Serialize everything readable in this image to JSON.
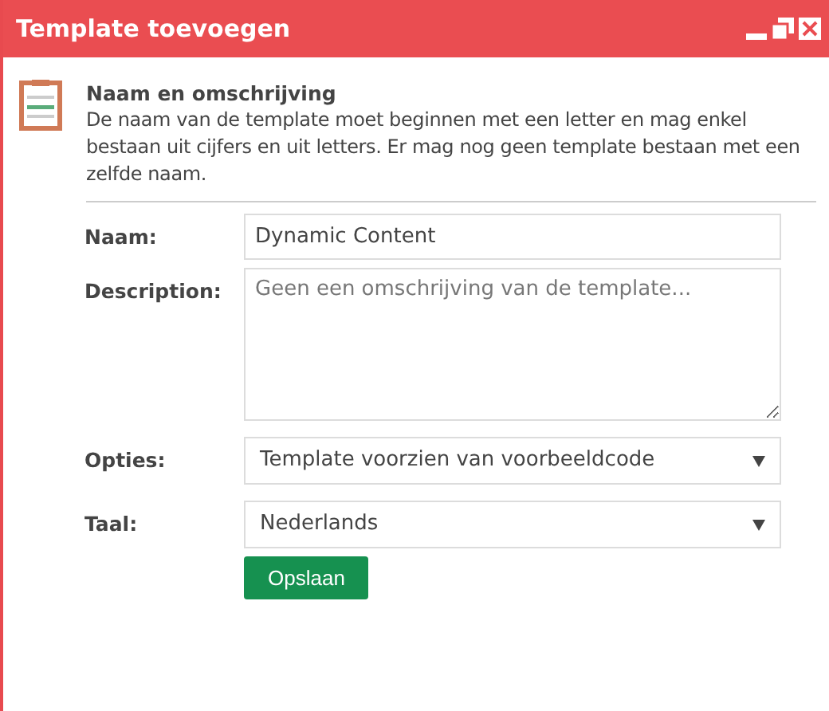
{
  "window": {
    "title": "Template toevoegen"
  },
  "section": {
    "title": "Naam en omschrijving",
    "description": "De naam van de template moet beginnen met een letter en mag enkel bestaan uit cijfers en uit letters. Er mag nog geen template bestaan met een zelfde naam."
  },
  "fields": [
    {
      "kind": "input",
      "label": "Naam:",
      "value": "Dynamic Content"
    },
    {
      "kind": "textarea",
      "label": "Description:",
      "placeholder": "Geen een omschrijving van de template..."
    },
    {
      "kind": "select",
      "label": "Opties:",
      "value": "Template voorzien van voorbeeldcode"
    },
    {
      "kind": "select",
      "label": "Taal:",
      "value": "Nederlands"
    }
  ],
  "buttons": [
    "Opslaan"
  ]
}
